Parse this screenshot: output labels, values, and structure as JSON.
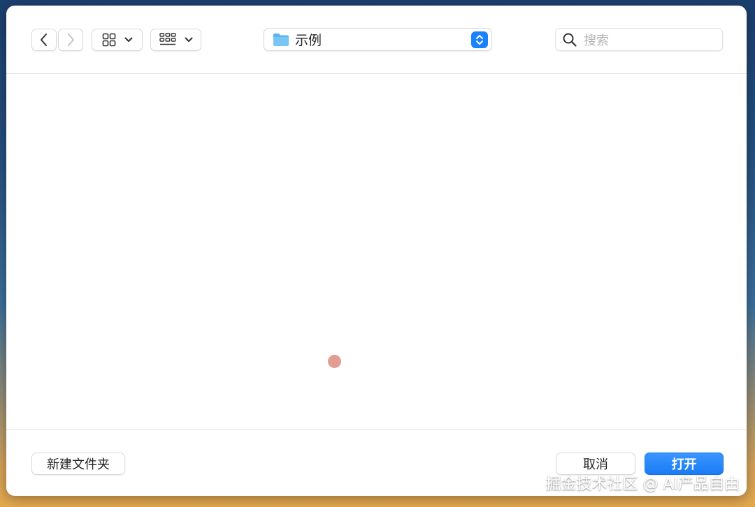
{
  "toolbar": {
    "back_icon": "chevron-left-icon",
    "forward_icon": "chevron-right-icon",
    "icon_view": "grid-icon",
    "gallery_view": "gallery-icon",
    "location": {
      "label": "示例",
      "icon": "folder-icon"
    },
    "search": {
      "placeholder": "搜索"
    }
  },
  "footer": {
    "new_folder_label": "新建文件夹",
    "cancel_label": "取消",
    "open_label": "打开"
  },
  "watermark": "掘金技术社区 @ AI产品自由",
  "colors": {
    "accent": "#1a82fb",
    "folder": "#5bb3ef",
    "cursor_dot": "#e39e94"
  }
}
